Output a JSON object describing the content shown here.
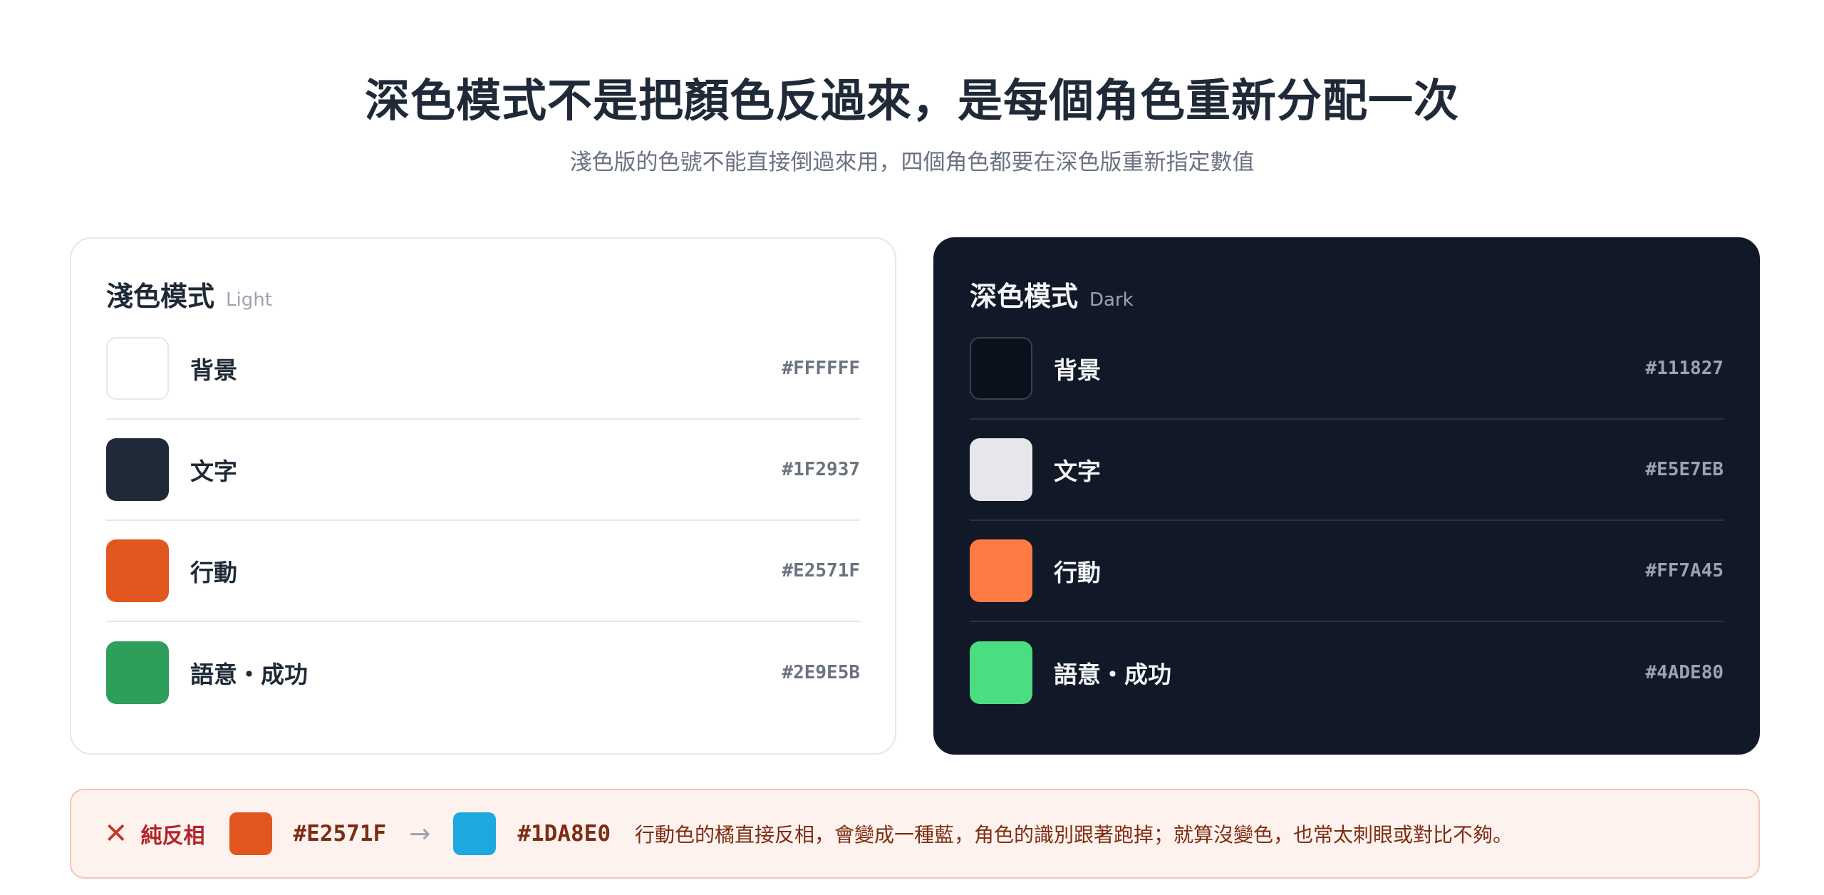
{
  "header": {
    "title": "深色模式不是把顏色反過來，是每個角色重新分配一次",
    "subtitle": "淺色版的色號不能直接倒過來用，四個角色都要在深色版重新指定數值"
  },
  "light": {
    "title": "淺色模式",
    "tag": "Light",
    "rows": [
      {
        "role": "背景",
        "hex": "#FFFFFF",
        "color": "#FFFFFF"
      },
      {
        "role": "文字",
        "hex": "#1F2937",
        "color": "#1F2937"
      },
      {
        "role": "行動",
        "hex": "#E2571F",
        "color": "#E2571F"
      },
      {
        "role": "語意・成功",
        "hex": "#2E9E5B",
        "color": "#2E9E5B"
      }
    ]
  },
  "dark": {
    "title": "深色模式",
    "tag": "Dark",
    "rows": [
      {
        "role": "背景",
        "hex": "#111827",
        "color": "#0B111C"
      },
      {
        "role": "文字",
        "hex": "#E5E7EB",
        "color": "#E5E7EB"
      },
      {
        "role": "行動",
        "hex": "#FF7A45",
        "color": "#FF7A45"
      },
      {
        "role": "語意・成功",
        "hex": "#4ADE80",
        "color": "#4ADE80"
      }
    ]
  },
  "warning": {
    "icon": "close-icon",
    "label": "純反相",
    "from_hex": "#E2571F",
    "from_color": "#E2571F",
    "arrow": "→",
    "to_hex": "#1DA8E0",
    "to_color": "#1DA8E0",
    "text": "行動色的橘直接反相，會變成一種藍，角色的識別跟著跑掉；就算沒變色，也常太刺眼或對比不夠。"
  }
}
